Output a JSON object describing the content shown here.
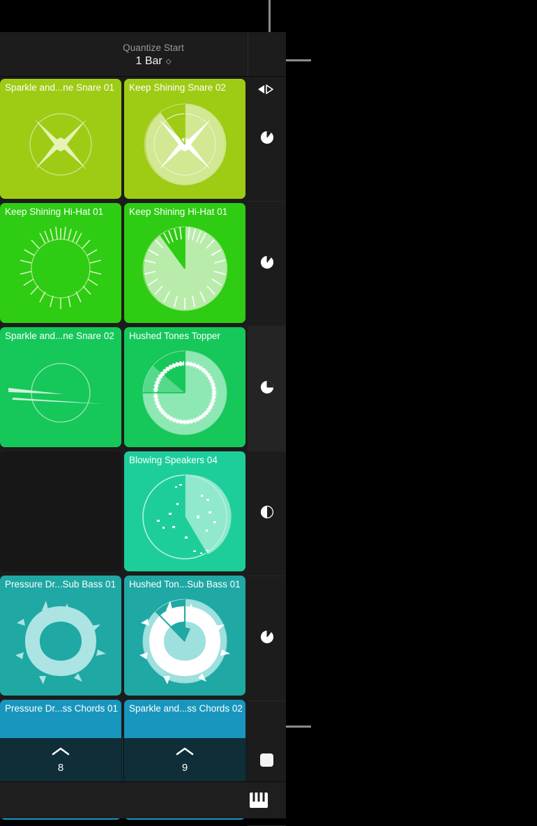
{
  "app": {
    "view_name": "Live Loops Grid",
    "background_color": "#000000",
    "panel_color": "#1c1c1c"
  },
  "header": {
    "quantize_label": "Quantize Start",
    "quantize_value": "1 Bar",
    "stepper_glyph": "◇",
    "quantize_icon": "pie-quarter-icon",
    "play_icon": "play-previous-next-icon"
  },
  "callouts": [
    {
      "name": "callout-line-top",
      "orientation": "vertical"
    },
    {
      "name": "callout-line-play",
      "orientation": "horizontal"
    },
    {
      "name": "callout-line-stop",
      "orientation": "horizontal"
    }
  ],
  "grid": {
    "columns": [
      {
        "index": 0,
        "number": "8"
      },
      {
        "index": 1,
        "number": "9"
      }
    ],
    "rows": [
      {
        "index": 0,
        "row_icon": "pie-eighth-icon",
        "row_icon_fill": 0.875,
        "highlighted": false,
        "cells": [
          {
            "title": "Sparkle and...ne Snare 01",
            "color": "#9ECB14",
            "art": "snare-burst",
            "playing": false,
            "empty": false
          },
          {
            "title": "Keep Shining Snare 02",
            "color": "#9ECB14",
            "art": "snare-burst",
            "playing": true,
            "progress": 0.875,
            "empty": false
          }
        ]
      },
      {
        "index": 1,
        "row_icon": "pie-eighth-icon",
        "row_icon_fill": 0.875,
        "highlighted": false,
        "cells": [
          {
            "title": "Keep Shining Hi-Hat 01",
            "color": "#2ECC12",
            "art": "hihat-ring",
            "playing": false,
            "empty": false
          },
          {
            "title": "Keep Shining Hi-Hat 01",
            "color": "#2ECC12",
            "art": "hihat-ring",
            "playing": true,
            "progress": 0.875,
            "empty": false
          }
        ]
      },
      {
        "index": 2,
        "row_icon": "pie-quarter-icon",
        "row_icon_fill": 0.75,
        "highlighted": true,
        "cells": [
          {
            "title": "Sparkle and...ne Snare 02",
            "color": "#16C75A",
            "art": "rim-circle",
            "playing": false,
            "empty": false
          },
          {
            "title": "Hushed Tones Topper",
            "color": "#16C75A",
            "art": "topper-ring",
            "playing": true,
            "progress": 0.75,
            "empty": false
          }
        ]
      },
      {
        "index": 3,
        "row_icon": "pie-half-icon",
        "row_icon_fill": 0.5,
        "highlighted": false,
        "cells": [
          {
            "title": "",
            "color": "#171717",
            "art": "none",
            "playing": false,
            "empty": true
          },
          {
            "title": "Blowing Speakers 04",
            "color": "#1DCE9B",
            "art": "speaker-dots",
            "playing": true,
            "progress": 0.55,
            "empty": false
          }
        ]
      },
      {
        "index": 4,
        "row_icon": "pie-eighth-icon",
        "row_icon_fill": 0.875,
        "highlighted": false,
        "cells": [
          {
            "title": "Pressure Dr...Sub Bass 01",
            "color": "#1FA8A4",
            "art": "bass-blob",
            "playing": false,
            "empty": false
          },
          {
            "title": "Hushed Ton...Sub Bass 01",
            "color": "#1FA8A4",
            "art": "bass-blob",
            "playing": true,
            "progress": 0.875,
            "empty": false
          }
        ]
      },
      {
        "index": 5,
        "row_icon": "",
        "row_icon_fill": 0,
        "highlighted": false,
        "cells": [
          {
            "title": "Pressure Dr...ss Chords 01",
            "color": "#1896BE",
            "art": "none",
            "playing": false,
            "empty": false
          },
          {
            "title": "Sparkle and...ss Chords 02",
            "color": "#1896BE",
            "art": "none",
            "playing": false,
            "empty": false
          }
        ]
      }
    ]
  },
  "bottom_bar": {
    "cells": [
      {
        "chevron_icon": "chevron-up-icon",
        "number": "8"
      },
      {
        "chevron_icon": "chevron-up-icon",
        "number": "9"
      }
    ],
    "stop_all_icon": "stop-square-icon"
  },
  "footer": {
    "keyboard_icon": "piano-keyboard-icon"
  }
}
